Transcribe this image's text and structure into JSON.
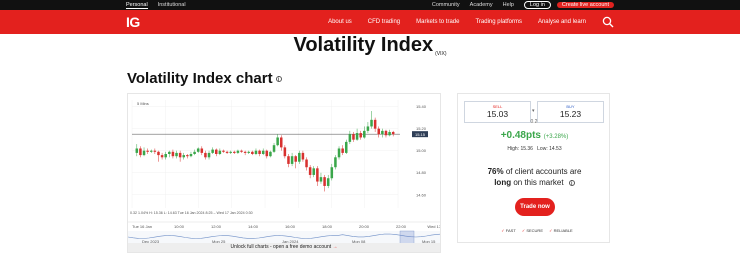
{
  "topbar": {
    "tabs": [
      "Personal",
      "Institutional"
    ],
    "links": [
      "Community",
      "Academy",
      "Help"
    ],
    "login": "Log in",
    "create_account": "Create live account"
  },
  "nav": {
    "logo": "IG",
    "items": [
      "About us",
      "CFD trading",
      "Markets to trade",
      "Trading platforms",
      "Analyse and learn"
    ]
  },
  "page": {
    "title": "Volatility Index",
    "ticker": "(VIX)",
    "chart_title": "Volatility Index chart"
  },
  "chart": {
    "interval": "5 Mins",
    "info_line": "0.32   1.04%   H: 15.36   L: 14.63   Tue 16 Jan 2024 8:25 – Wed 17 Jan 2024 0:30",
    "y_ticks": [
      "15.40",
      "15.20",
      "15.00",
      "14.80",
      "14.60"
    ],
    "current_price": "15.15",
    "x_ticks": [
      "Tue 16 Jan",
      "10:00",
      "12:00",
      "14:00",
      "16:00",
      "18:00",
      "20:00",
      "22:00",
      "Wed 17 Jan"
    ],
    "nav_ticks": [
      "Dec 2023",
      "Mon 25",
      "Jan 2024",
      "Mon 08",
      "Mon 15"
    ],
    "unlock_text": "Unlock full charts - open a free demo account",
    "unlock_arrow": "→"
  },
  "chart_data": {
    "type": "candlestick",
    "ylim": [
      14.48,
      15.46
    ],
    "candles": [
      {
        "o": 14.98,
        "c": 15.02,
        "h": 15.06,
        "l": 14.95
      },
      {
        "o": 15.02,
        "c": 14.96,
        "h": 15.04,
        "l": 14.94
      },
      {
        "o": 14.96,
        "c": 15.0,
        "h": 15.03,
        "l": 14.95
      },
      {
        "o": 15.0,
        "c": 14.99,
        "h": 15.02,
        "l": 14.97
      },
      {
        "o": 14.99,
        "c": 15.0,
        "h": 15.01,
        "l": 14.98
      },
      {
        "o": 15.0,
        "c": 14.99,
        "h": 15.02,
        "l": 14.97
      },
      {
        "o": 14.99,
        "c": 14.96,
        "h": 15.0,
        "l": 14.9
      },
      {
        "o": 14.96,
        "c": 14.94,
        "h": 14.98,
        "l": 14.92
      },
      {
        "o": 14.94,
        "c": 14.97,
        "h": 14.99,
        "l": 14.92
      },
      {
        "o": 14.97,
        "c": 14.99,
        "h": 15.0,
        "l": 14.94
      },
      {
        "o": 14.99,
        "c": 14.95,
        "h": 15.01,
        "l": 14.93
      },
      {
        "o": 14.95,
        "c": 14.98,
        "h": 15.0,
        "l": 14.93
      },
      {
        "o": 14.98,
        "c": 14.94,
        "h": 15.0,
        "l": 14.9
      },
      {
        "o": 14.94,
        "c": 14.96,
        "h": 14.98,
        "l": 14.92
      },
      {
        "o": 14.96,
        "c": 14.95,
        "h": 14.97,
        "l": 14.93
      },
      {
        "o": 14.95,
        "c": 14.97,
        "h": 14.99,
        "l": 14.94
      },
      {
        "o": 14.97,
        "c": 14.99,
        "h": 15.01,
        "l": 14.96
      },
      {
        "o": 14.99,
        "c": 15.02,
        "h": 15.03,
        "l": 14.98
      },
      {
        "o": 15.02,
        "c": 14.98,
        "h": 15.04,
        "l": 14.96
      },
      {
        "o": 14.98,
        "c": 14.94,
        "h": 15.0,
        "l": 14.92
      },
      {
        "o": 14.94,
        "c": 14.98,
        "h": 15.0,
        "l": 14.92
      },
      {
        "o": 14.98,
        "c": 15.01,
        "h": 15.03,
        "l": 14.97
      },
      {
        "o": 15.01,
        "c": 14.97,
        "h": 15.02,
        "l": 14.95
      },
      {
        "o": 14.97,
        "c": 15.0,
        "h": 15.02,
        "l": 14.96
      },
      {
        "o": 15.0,
        "c": 14.99,
        "h": 15.01,
        "l": 14.98
      },
      {
        "o": 14.99,
        "c": 14.98,
        "h": 15.0,
        "l": 14.97
      },
      {
        "o": 14.98,
        "c": 14.99,
        "h": 15.0,
        "l": 14.97
      },
      {
        "o": 14.99,
        "c": 14.98,
        "h": 15.0,
        "l": 14.97
      },
      {
        "o": 14.98,
        "c": 15.0,
        "h": 15.01,
        "l": 14.97
      },
      {
        "o": 15.0,
        "c": 14.99,
        "h": 15.01,
        "l": 14.98
      },
      {
        "o": 14.99,
        "c": 14.98,
        "h": 15.0,
        "l": 14.96
      },
      {
        "o": 14.98,
        "c": 14.99,
        "h": 15.0,
        "l": 14.97
      },
      {
        "o": 14.99,
        "c": 14.97,
        "h": 15.0,
        "l": 14.96
      },
      {
        "o": 14.97,
        "c": 15.0,
        "h": 15.02,
        "l": 14.96
      },
      {
        "o": 15.0,
        "c": 14.97,
        "h": 15.01,
        "l": 14.95
      },
      {
        "o": 14.97,
        "c": 15.0,
        "h": 15.02,
        "l": 14.96
      },
      {
        "o": 15.0,
        "c": 14.95,
        "h": 15.01,
        "l": 14.93
      },
      {
        "o": 14.95,
        "c": 14.99,
        "h": 15.0,
        "l": 14.94
      },
      {
        "o": 14.99,
        "c": 15.05,
        "h": 15.07,
        "l": 14.98
      },
      {
        "o": 15.05,
        "c": 15.12,
        "h": 15.15,
        "l": 15.04
      },
      {
        "o": 15.12,
        "c": 15.03,
        "h": 15.14,
        "l": 15.0
      },
      {
        "o": 15.03,
        "c": 14.95,
        "h": 15.05,
        "l": 14.93
      },
      {
        "o": 14.95,
        "c": 14.88,
        "h": 14.97,
        "l": 14.85
      },
      {
        "o": 14.88,
        "c": 14.95,
        "h": 14.98,
        "l": 14.86
      },
      {
        "o": 14.95,
        "c": 14.9,
        "h": 14.96,
        "l": 14.84
      },
      {
        "o": 14.9,
        "c": 14.98,
        "h": 15.0,
        "l": 14.88
      },
      {
        "o": 14.98,
        "c": 14.92,
        "h": 15.0,
        "l": 14.9
      },
      {
        "o": 14.92,
        "c": 14.85,
        "h": 14.94,
        "l": 14.82
      },
      {
        "o": 14.85,
        "c": 14.78,
        "h": 14.87,
        "l": 14.75
      },
      {
        "o": 14.78,
        "c": 14.84,
        "h": 14.86,
        "l": 14.76
      },
      {
        "o": 14.84,
        "c": 14.72,
        "h": 14.86,
        "l": 14.68
      },
      {
        "o": 14.72,
        "c": 14.76,
        "h": 14.8,
        "l": 14.7
      },
      {
        "o": 14.76,
        "c": 14.68,
        "h": 14.78,
        "l": 14.63
      },
      {
        "o": 14.68,
        "c": 14.75,
        "h": 14.78,
        "l": 14.66
      },
      {
        "o": 14.75,
        "c": 14.85,
        "h": 14.88,
        "l": 14.73
      },
      {
        "o": 14.85,
        "c": 14.94,
        "h": 14.96,
        "l": 14.83
      },
      {
        "o": 14.94,
        "c": 15.02,
        "h": 15.04,
        "l": 14.92
      },
      {
        "o": 15.02,
        "c": 14.98,
        "h": 15.05,
        "l": 14.96
      },
      {
        "o": 14.98,
        "c": 15.08,
        "h": 15.1,
        "l": 14.97
      },
      {
        "o": 15.08,
        "c": 15.15,
        "h": 15.18,
        "l": 15.06
      },
      {
        "o": 15.15,
        "c": 15.1,
        "h": 15.17,
        "l": 15.08
      },
      {
        "o": 15.1,
        "c": 15.16,
        "h": 15.2,
        "l": 15.09
      },
      {
        "o": 15.16,
        "c": 15.12,
        "h": 15.18,
        "l": 15.1
      },
      {
        "o": 15.12,
        "c": 15.18,
        "h": 15.22,
        "l": 15.11
      },
      {
        "o": 15.18,
        "c": 15.22,
        "h": 15.26,
        "l": 15.16
      },
      {
        "o": 15.22,
        "c": 15.28,
        "h": 15.36,
        "l": 15.2
      },
      {
        "o": 15.28,
        "c": 15.2,
        "h": 15.3,
        "l": 15.17
      },
      {
        "o": 15.2,
        "c": 15.15,
        "h": 15.22,
        "l": 15.12
      },
      {
        "o": 15.15,
        "c": 15.18,
        "h": 15.2,
        "l": 15.12
      },
      {
        "o": 15.18,
        "c": 15.14,
        "h": 15.19,
        "l": 15.12
      },
      {
        "o": 15.14,
        "c": 15.17,
        "h": 15.19,
        "l": 15.13
      },
      {
        "o": 15.17,
        "c": 15.15,
        "h": 15.18,
        "l": 15.13
      }
    ],
    "current": 15.15
  },
  "side": {
    "sell_label": "SELL",
    "sell_price": "15.03",
    "buy_label": "BUY",
    "buy_price": "15.23",
    "spread": "0.2",
    "change": "+0.48pts",
    "change_pct": "(+3.28%)",
    "high_label": "High:",
    "high": "15.36",
    "low_label": "Low:",
    "low": "14.53",
    "sentiment_pct": "76%",
    "sentiment_mid": " of client accounts are",
    "sentiment_long": "long",
    "sentiment_end": " on this market",
    "trade_button": "Trade now",
    "features": [
      "FAST",
      "SECURE",
      "RELIABLE"
    ],
    "colors": {
      "up": "#3aa64a",
      "down": "#d8312f",
      "brand": "#e3211e"
    }
  }
}
